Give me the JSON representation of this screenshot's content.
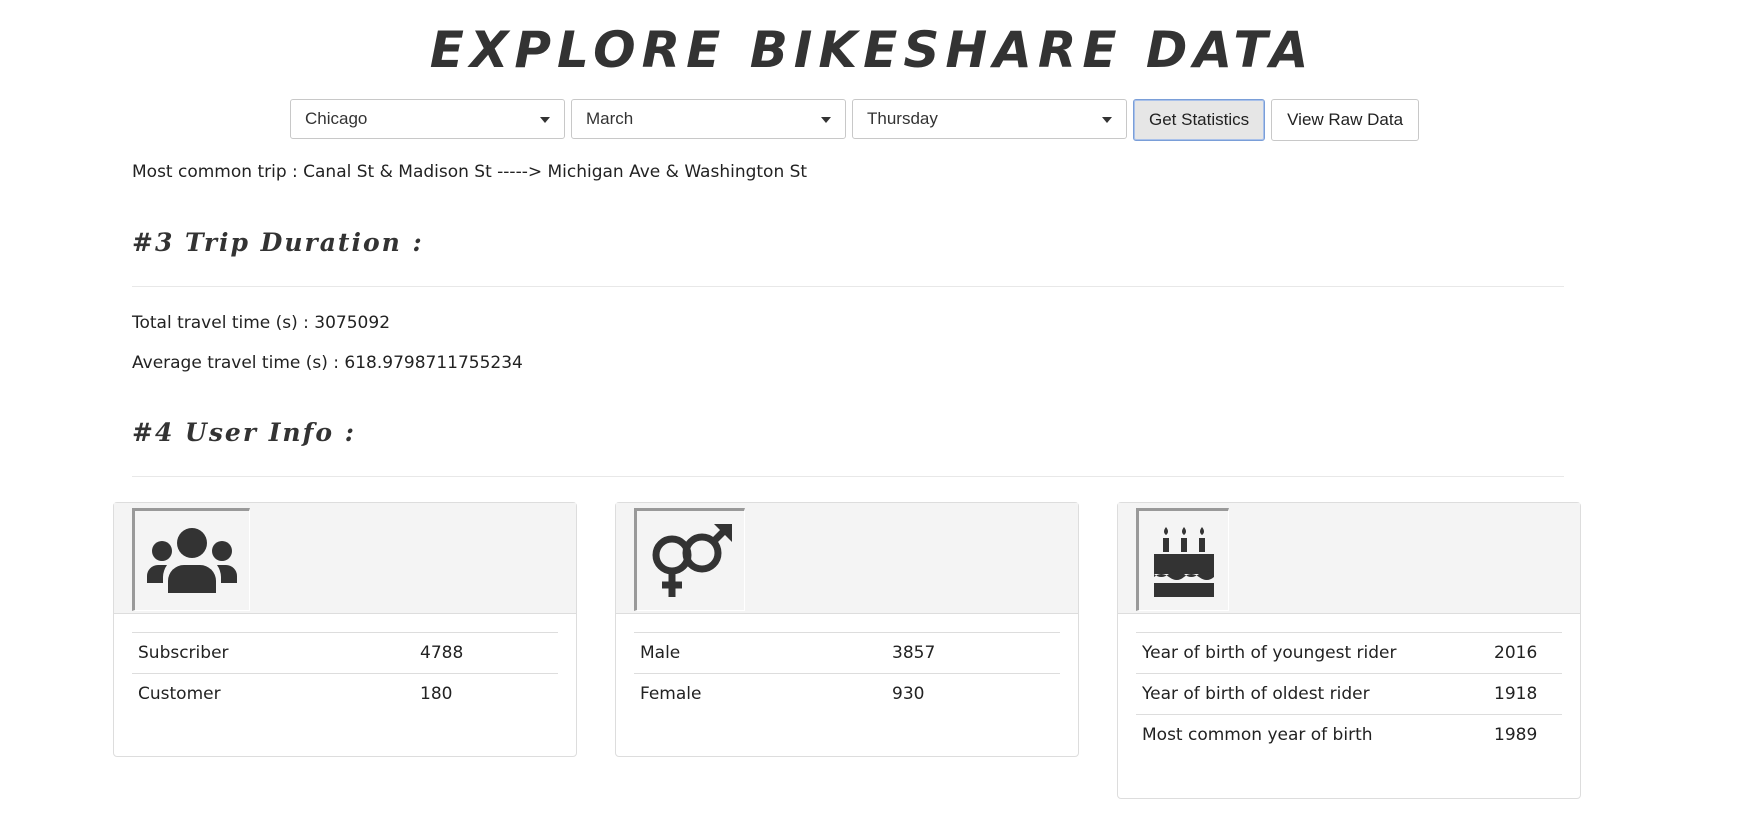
{
  "header": {
    "title": "EXPLORE BIKESHARE DATA"
  },
  "filters": {
    "city": "Chicago",
    "month": "March",
    "day": "Thursday",
    "get_statistics_label": "Get Statistics",
    "view_raw_data_label": "View Raw Data"
  },
  "stations": {
    "most_common_trip": "Most common trip : Canal St & Madison St -----> Michigan Ave & Washington St"
  },
  "trip_duration": {
    "heading": "#3 Trip Duration :",
    "total_travel_time": "Total travel time (s) : 3075092",
    "average_travel_time": "Average travel time (s) : 618.9798711755234"
  },
  "user_info": {
    "heading": "#4 User Info :",
    "user_types": {
      "icon": "users-icon",
      "rows": [
        {
          "label": "Subscriber",
          "value": "4788"
        },
        {
          "label": "Customer",
          "value": "180"
        }
      ]
    },
    "gender": {
      "icon": "venus-mars-icon",
      "rows": [
        {
          "label": "Male",
          "value": "3857"
        },
        {
          "label": "Female",
          "value": "930"
        }
      ]
    },
    "birth_year": {
      "icon": "birthday-cake-icon",
      "rows": [
        {
          "label": "Year of birth of youngest rider",
          "value": "2016"
        },
        {
          "label": "Year of birth of oldest rider",
          "value": "1918"
        },
        {
          "label": "Most common year of birth",
          "value": "1989"
        }
      ]
    }
  },
  "colors": {
    "text": "#222222",
    "icon": "#333333",
    "card_header_bg": "#f4f4f4",
    "border": "#dddddd",
    "active_button_border": "#7a9ed8"
  }
}
